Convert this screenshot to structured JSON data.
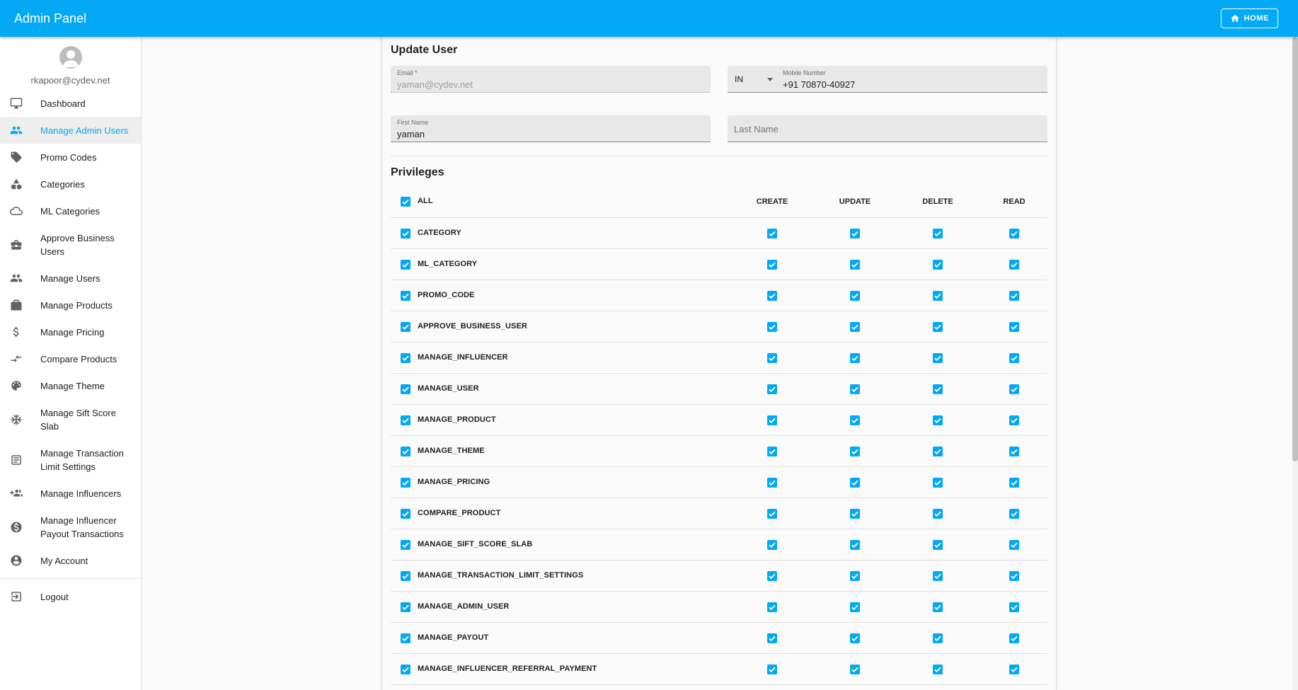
{
  "appbar": {
    "title": "Admin Panel",
    "home_label": "HOME"
  },
  "colors": {
    "primary": "#03a9f4",
    "checkbox": "#03a9f4",
    "active_bg": "#eeeeee"
  },
  "profile": {
    "email": "rkapoor@cydev.net"
  },
  "sidebar": {
    "items": [
      {
        "label": "Dashboard",
        "icon": "monitor-icon"
      },
      {
        "label": "Manage Admin Users",
        "icon": "people-icon",
        "active": true
      },
      {
        "label": "Promo Codes",
        "icon": "tag-icon"
      },
      {
        "label": "Categories",
        "icon": "shapes-icon"
      },
      {
        "label": "ML Categories",
        "icon": "cloud-icon"
      },
      {
        "label": "Approve Business Users",
        "icon": "briefcase-icon"
      },
      {
        "label": "Manage Users",
        "icon": "group-icon"
      },
      {
        "label": "Manage Products",
        "icon": "products-icon"
      },
      {
        "label": "Manage Pricing",
        "icon": "dollar-icon"
      },
      {
        "label": "Compare Products",
        "icon": "compare-arrows-icon"
      },
      {
        "label": "Manage Theme",
        "icon": "palette-icon"
      },
      {
        "label": "Manage Sift Score Slab",
        "icon": "snowflake-icon"
      },
      {
        "label": "Manage Transaction Limit Settings",
        "icon": "list-icon"
      },
      {
        "label": "Manage Influencers",
        "icon": "group-add-icon"
      },
      {
        "label": "Manage Influencer Payout Transactions",
        "icon": "money-icon"
      },
      {
        "label": "My Account",
        "icon": "account-circle-icon"
      }
    ],
    "logout": {
      "label": "Logout",
      "icon": "logout-icon"
    }
  },
  "form": {
    "title": "Update User",
    "email": {
      "label": "Email *",
      "value": "yaman@cydev.net"
    },
    "country": {
      "value": "IN"
    },
    "mobile": {
      "label": "Mobile Number",
      "value": "+91 70870-40927"
    },
    "first_name": {
      "label": "First Name",
      "value": "yaman"
    },
    "last_name": {
      "placeholder": "Last Name"
    }
  },
  "privileges": {
    "title": "Privileges",
    "all_label": "ALL",
    "columns": [
      "CREATE",
      "UPDATE",
      "DELETE",
      "READ"
    ],
    "rows": [
      "CATEGORY",
      "ML_CATEGORY",
      "PROMO_CODE",
      "APPROVE_BUSINESS_USER",
      "MANAGE_INFLUENCER",
      "MANAGE_USER",
      "MANAGE_PRODUCT",
      "MANAGE_THEME",
      "MANAGE_PRICING",
      "COMPARE_PRODUCT",
      "MANAGE_SIFT_SCORE_SLAB",
      "MANAGE_TRANSACTION_LIMIT_SETTINGS",
      "MANAGE_ADMIN_USER",
      "MANAGE_PAYOUT",
      "MANAGE_INFLUENCER_REFERRAL_PAYMENT"
    ]
  }
}
